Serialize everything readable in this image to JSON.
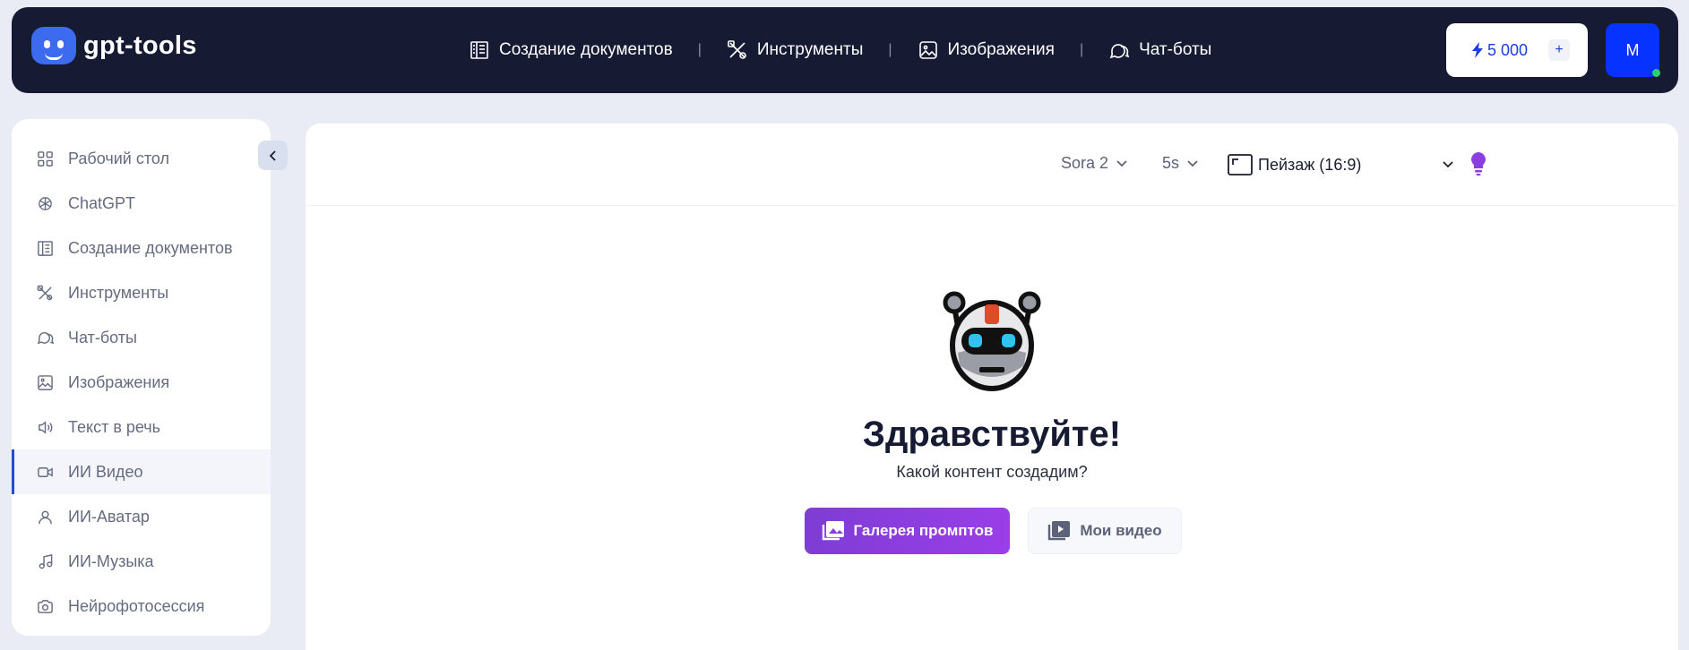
{
  "header": {
    "logo_text": "gpt-tools",
    "nav": [
      {
        "label": "Создание документов",
        "icon": "document-icon"
      },
      {
        "label": "Инструменты",
        "icon": "tools-icon"
      },
      {
        "label": "Изображения",
        "icon": "image-icon"
      },
      {
        "label": "Чат-боты",
        "icon": "chat-icon"
      }
    ],
    "nav_separator": "|",
    "balance": "5 000",
    "balance_add": "+",
    "avatar_letter": "M"
  },
  "sidebar": {
    "items": [
      {
        "label": "Рабочий стол",
        "icon": "dashboard-icon",
        "active": false
      },
      {
        "label": "ChatGPT",
        "icon": "openai-icon",
        "active": false
      },
      {
        "label": "Создание документов",
        "icon": "document-icon",
        "active": false
      },
      {
        "label": "Инструменты",
        "icon": "tools-icon",
        "active": false
      },
      {
        "label": "Чат-боты",
        "icon": "chat-icon",
        "active": false
      },
      {
        "label": "Изображения",
        "icon": "image-icon",
        "active": false
      },
      {
        "label": "Текст в речь",
        "icon": "speaker-icon",
        "active": false
      },
      {
        "label": "ИИ Видео",
        "icon": "video-icon",
        "active": true
      },
      {
        "label": "ИИ-Аватар",
        "icon": "user-icon",
        "active": false
      },
      {
        "label": "ИИ-Музыка",
        "icon": "music-icon",
        "active": false
      },
      {
        "label": "Нейрофотосессия",
        "icon": "camera-icon",
        "active": false
      }
    ]
  },
  "toolbar": {
    "model": "Sora 2",
    "duration": "5s",
    "aspect": "Пейзаж (16:9)"
  },
  "main": {
    "greeting": "Здравствуйте!",
    "subtitle": "Какой контент создадим?",
    "gallery_button": "Галерея промптов",
    "videos_button": "Мои видео"
  },
  "colors": {
    "topbar_bg": "#161b33",
    "accent_blue": "#0633ff",
    "accent_purple": "#8b3ee0",
    "active_indicator": "#2949d8"
  }
}
